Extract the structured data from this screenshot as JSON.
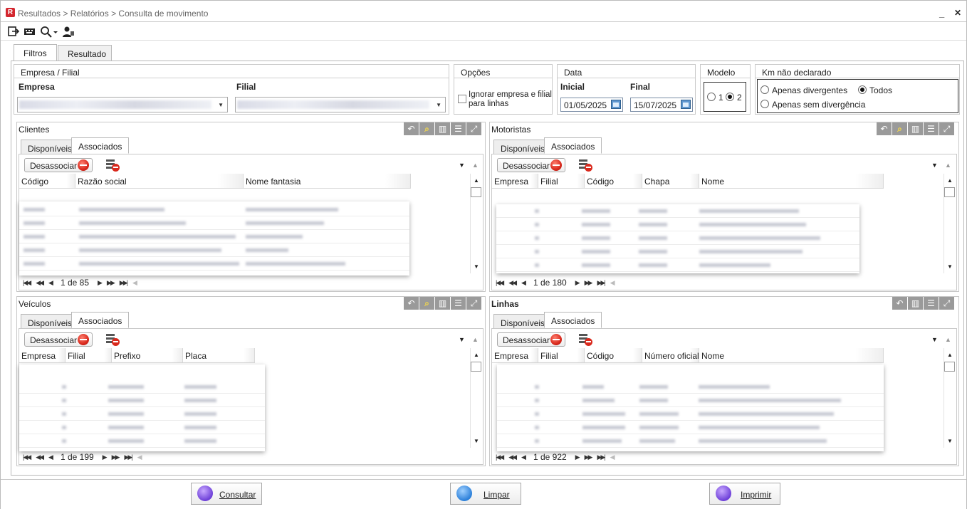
{
  "window": {
    "title": "Resultados > Relatórios > Consulta de movimento",
    "minimize": "_",
    "close": "✕"
  },
  "toolbar": {
    "icons": [
      "exit-icon",
      "keyboard-icon",
      "search-dropdown-icon",
      "user-icon"
    ]
  },
  "tabs": {
    "filtros": "Filtros",
    "resultado": "Resultado"
  },
  "empresa_filial": {
    "title": "Empresa / Filial",
    "empresa_label": "Empresa",
    "filial_label": "Filial"
  },
  "opcoes": {
    "title": "Opções",
    "ignorar": "Ignorar empresa e filial para linhas",
    "ignorar_checked": false
  },
  "data": {
    "title": "Data",
    "inicial_label": "Inicial",
    "final_label": "Final",
    "inicial": "01/05/2025",
    "final": "15/07/2025"
  },
  "modelo": {
    "title": "Modelo",
    "opt1": "1",
    "opt2": "2",
    "selected": "2"
  },
  "km": {
    "title": "Km não declarado",
    "apenas_divergentes": "Apenas divergentes",
    "todos": "Todos",
    "apenas_sem": "Apenas sem divergência",
    "selected": "Todos"
  },
  "clientes": {
    "title": "Clientes",
    "tab_disp": "Disponíveis",
    "tab_assoc": "Associados",
    "desassociar": "Desassociar",
    "cols": [
      "Código",
      "Razão social",
      "Nome fantasia"
    ],
    "pager": "1 de 85"
  },
  "motoristas": {
    "title": "Motoristas",
    "tab_disp": "Disponíveis",
    "tab_assoc": "Associados",
    "desassociar": "Desassociar",
    "cols": [
      "Empresa",
      "Filial",
      "Código",
      "Chapa",
      "Nome"
    ],
    "pager": "1 de 180"
  },
  "veiculos": {
    "title": "Veículos",
    "tab_disp": "Disponíveis",
    "tab_assoc": "Associados",
    "desassociar": "Desassociar",
    "cols": [
      "Empresa",
      "Filial",
      "Prefixo",
      "Placa"
    ],
    "pager": "1 de 199"
  },
  "linhas": {
    "title": "Linhas",
    "tab_disp": "Disponíveis",
    "tab_assoc": "Associados",
    "desassociar": "Desassociar",
    "cols": [
      "Empresa",
      "Filial",
      "Código",
      "Número oficial",
      "Nome"
    ],
    "pager": "1 de 922"
  },
  "buttons": {
    "consultar": "Consultar",
    "limpar": "Limpar",
    "imprimir": "Imprimir"
  },
  "colors": {
    "accent": "#d3262e",
    "panel_icon": "#9a9a9a"
  }
}
